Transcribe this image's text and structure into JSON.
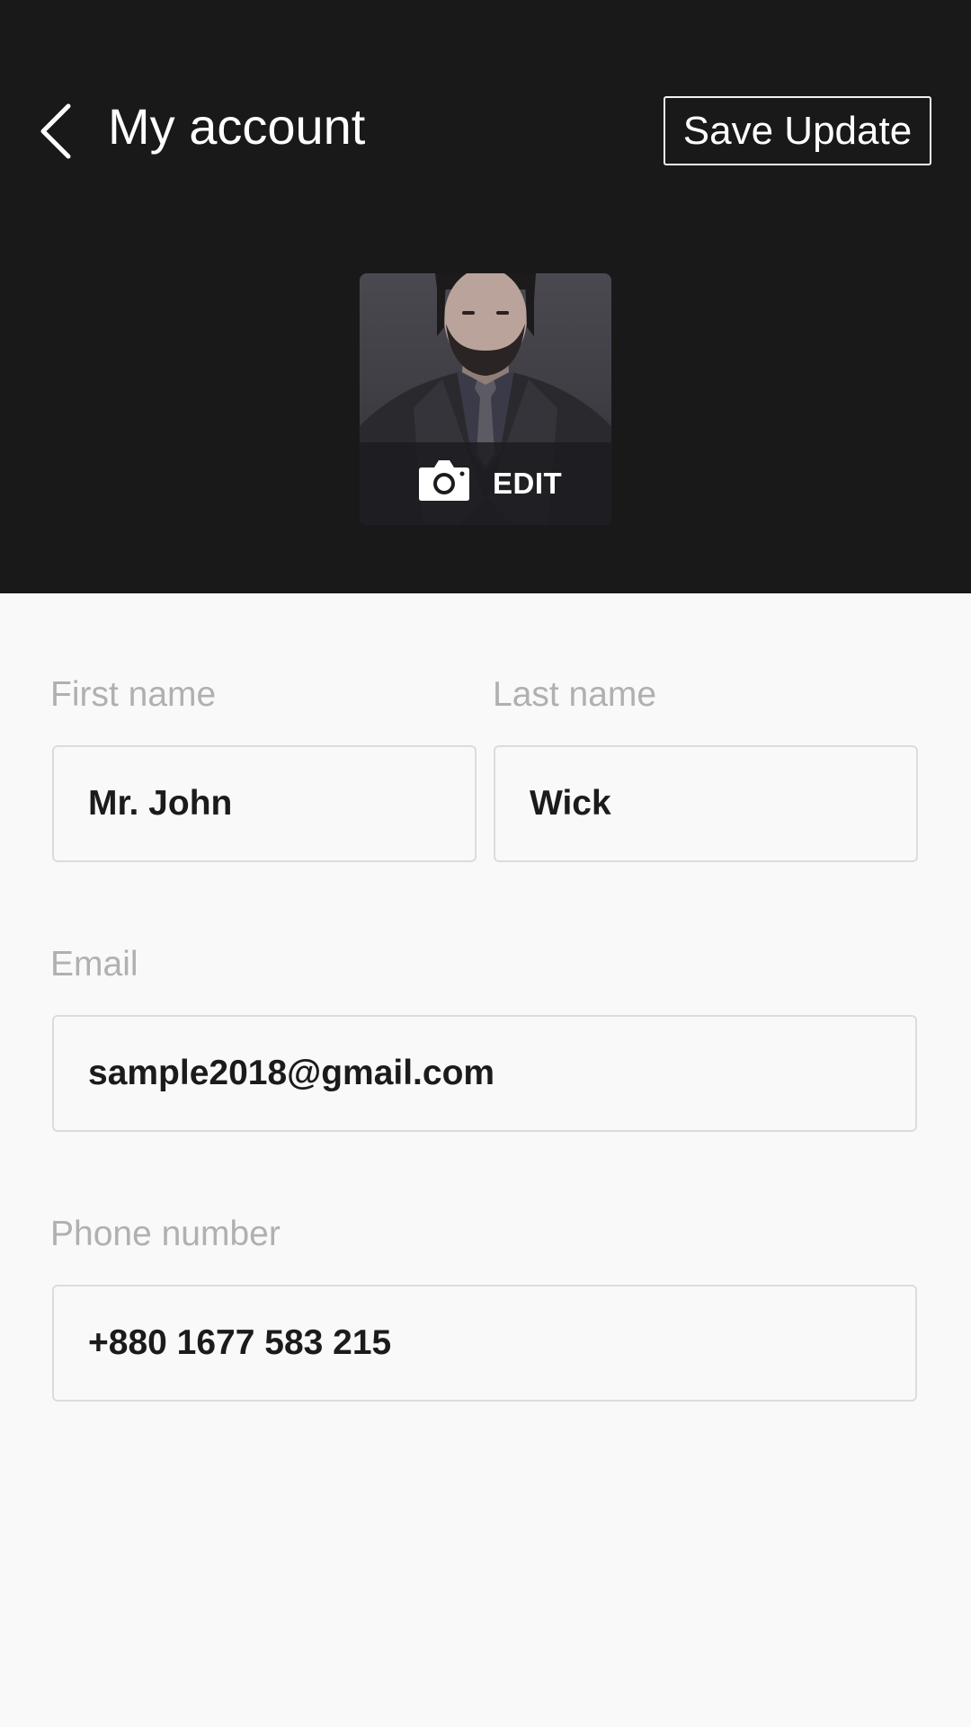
{
  "header": {
    "title": "My account",
    "save_label": "Save Update",
    "back_icon": "chevron-left-icon"
  },
  "avatar": {
    "edit_label": "EDIT",
    "camera_icon": "camera-icon"
  },
  "form": {
    "first_name": {
      "label": "First name",
      "value": "Mr. John"
    },
    "last_name": {
      "label": "Last name",
      "value": "Wick"
    },
    "email": {
      "label": "Email",
      "value": "sample2018@gmail.com"
    },
    "phone": {
      "label": "Phone number",
      "value": "+880 1677 583 215"
    }
  },
  "colors": {
    "header_bg": "#1a191a",
    "page_bg": "#f9f9f9",
    "label_text": "#b0b0b0",
    "value_text": "#1b1b1b",
    "field_border": "#dcdcdc"
  }
}
